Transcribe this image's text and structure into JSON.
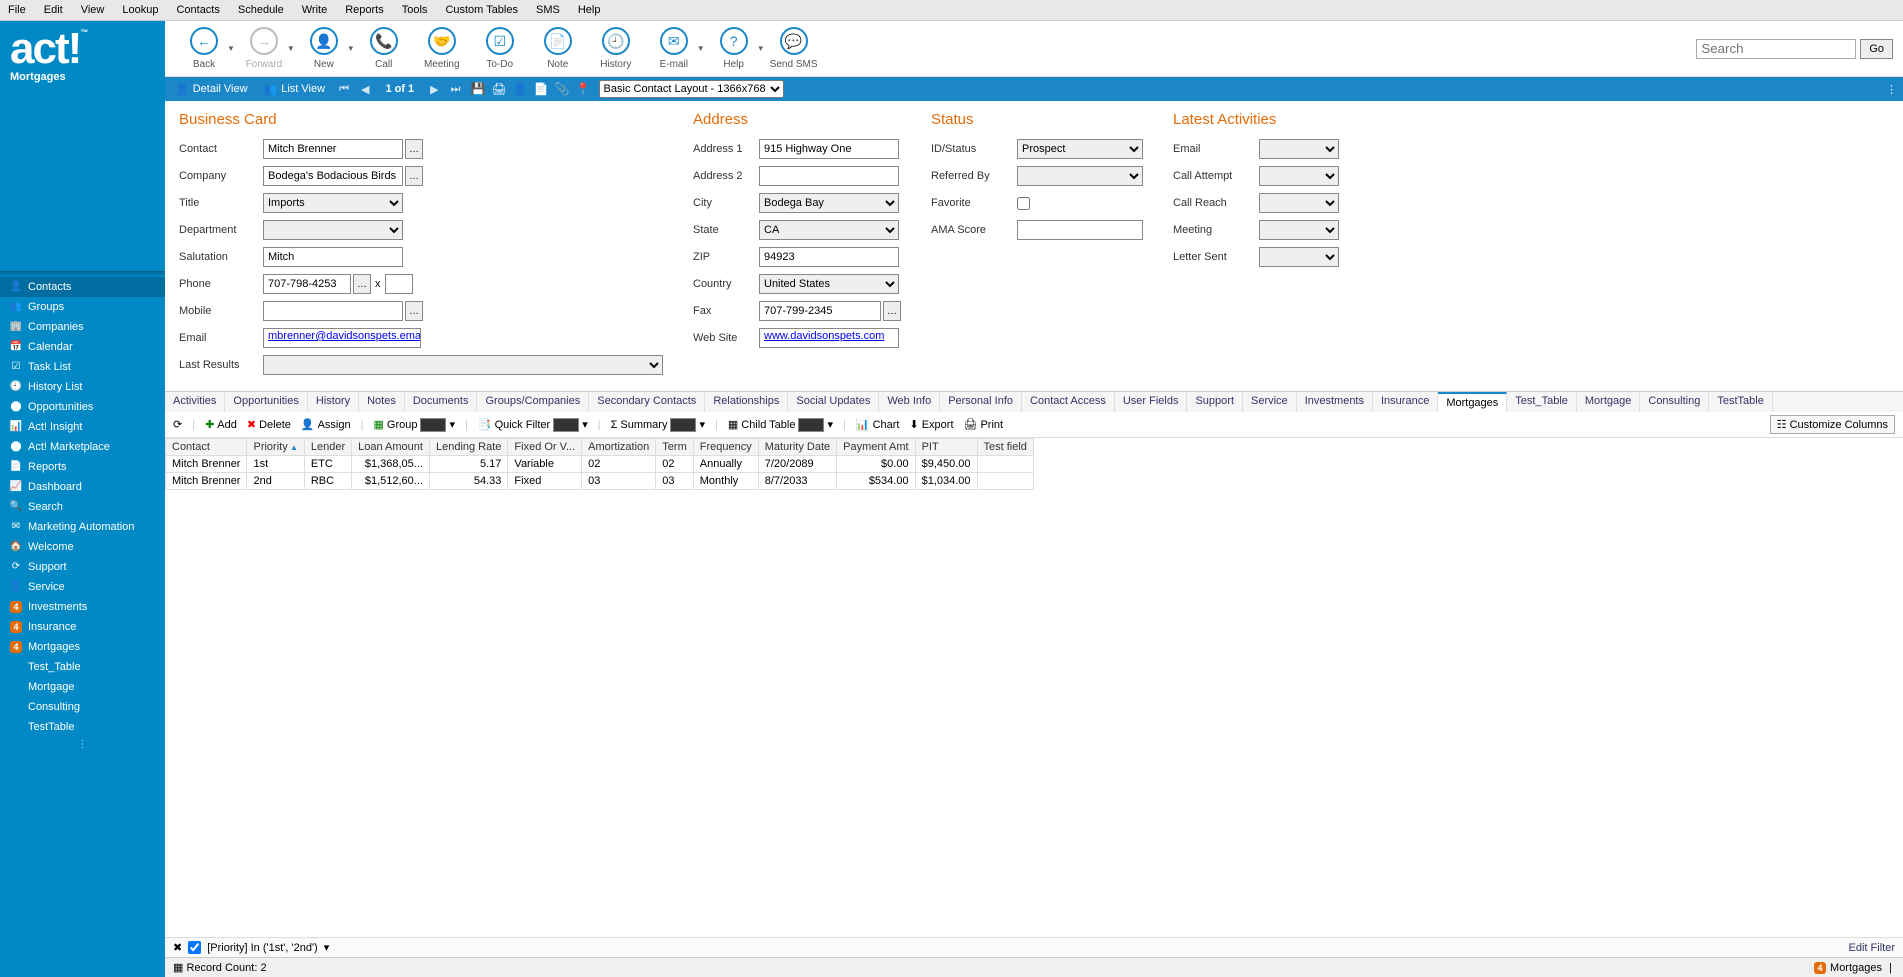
{
  "menu": [
    "File",
    "Edit",
    "View",
    "Lookup",
    "Contacts",
    "Schedule",
    "Write",
    "Reports",
    "Tools",
    "Custom Tables",
    "SMS",
    "Help"
  ],
  "logo": {
    "text": "act!",
    "sub": "Mortgages"
  },
  "toolbar": [
    {
      "id": "back",
      "label": "Back",
      "icon": "←",
      "drop": true
    },
    {
      "id": "forward",
      "label": "Forward",
      "icon": "→",
      "disabled": true,
      "drop": true
    },
    {
      "id": "new",
      "label": "New",
      "icon": "👤",
      "drop": true
    },
    {
      "id": "call",
      "label": "Call",
      "icon": "📞"
    },
    {
      "id": "meeting",
      "label": "Meeting",
      "icon": "🤝"
    },
    {
      "id": "todo",
      "label": "To-Do",
      "icon": "☑"
    },
    {
      "id": "note",
      "label": "Note",
      "icon": "📄"
    },
    {
      "id": "history",
      "label": "History",
      "icon": "🕘"
    },
    {
      "id": "email",
      "label": "E-mail",
      "icon": "✉",
      "drop": true
    },
    {
      "id": "help",
      "label": "Help",
      "icon": "?",
      "drop": true
    },
    {
      "id": "sendsms",
      "label": "Send SMS",
      "icon": "💬"
    }
  ],
  "search": {
    "placeholder": "Search",
    "go": "Go"
  },
  "subbar": {
    "detail": "Detail View",
    "list": "List View",
    "paging": "1 of 1",
    "layoutSelect": "Basic Contact Layout - 1366x768"
  },
  "nav": [
    {
      "id": "contacts",
      "label": "Contacts",
      "icon": "👤",
      "active": true
    },
    {
      "id": "groups",
      "label": "Groups",
      "icon": "👥"
    },
    {
      "id": "companies",
      "label": "Companies",
      "icon": "🏢"
    },
    {
      "id": "calendar",
      "label": "Calendar",
      "icon": "📅"
    },
    {
      "id": "tasklist",
      "label": "Task List",
      "icon": "☑"
    },
    {
      "id": "historylist",
      "label": "History List",
      "icon": "🕘"
    },
    {
      "id": "opportunities",
      "label": "Opportunities",
      "icon": "⬤"
    },
    {
      "id": "insight",
      "label": "Act! Insight",
      "icon": "📊"
    },
    {
      "id": "marketplace",
      "label": "Act! Marketplace",
      "icon": "⬤"
    },
    {
      "id": "reports",
      "label": "Reports",
      "icon": "📄"
    },
    {
      "id": "dashboard",
      "label": "Dashboard",
      "icon": "📈"
    },
    {
      "id": "searchnav",
      "label": "Search",
      "icon": "🔍"
    },
    {
      "id": "marketing",
      "label": "Marketing Automation",
      "icon": "✉"
    },
    {
      "id": "welcome",
      "label": "Welcome",
      "icon": "🏠"
    },
    {
      "id": "support",
      "label": "Support",
      "icon": "⟳"
    },
    {
      "id": "service",
      "label": "Service",
      "icon": "👤"
    },
    {
      "id": "investments",
      "label": "Investments",
      "icon": "4",
      "badge": true
    },
    {
      "id": "insurance",
      "label": "Insurance",
      "icon": "4",
      "badge": true
    },
    {
      "id": "mortgages",
      "label": "Mortgages",
      "icon": "4",
      "badge": true
    },
    {
      "id": "testtable",
      "label": "Test_Table",
      "icon": ""
    },
    {
      "id": "mortgage",
      "label": "Mortgage",
      "icon": ""
    },
    {
      "id": "consulting",
      "label": "Consulting",
      "icon": ""
    },
    {
      "id": "testtable2",
      "label": "TestTable",
      "icon": ""
    }
  ],
  "sections": {
    "businessCard": "Business Card",
    "address": "Address",
    "status": "Status",
    "latest": "Latest Activities"
  },
  "labels": {
    "contact": "Contact",
    "company": "Company",
    "title": "Title",
    "department": "Department",
    "salutation": "Salutation",
    "phone": "Phone",
    "mobile": "Mobile",
    "email": "Email",
    "lastResults": "Last Results",
    "address1": "Address 1",
    "address2": "Address 2",
    "city": "City",
    "state": "State",
    "zip": "ZIP",
    "country": "Country",
    "fax": "Fax",
    "website": "Web Site",
    "idstatus": "ID/Status",
    "referredby": "Referred By",
    "favorite": "Favorite",
    "amascore": "AMA Score",
    "aemail": "Email",
    "callattempt": "Call Attempt",
    "callreach": "Call Reach",
    "meeting": "Meeting",
    "lettersent": "Letter Sent",
    "x": "x"
  },
  "values": {
    "contact": "Mitch Brenner",
    "company": "Bodega's Bodacious Birds",
    "title": "Imports",
    "department": "",
    "salutation": "Mitch",
    "phone": "707-798-4253",
    "mobile": "",
    "email": "mbrenner@davidsonspets.ema",
    "lastResults": "",
    "address1": "915 Highway One",
    "address2": "",
    "city": "Bodega Bay",
    "state": "CA",
    "zip": "94923",
    "country": "United States",
    "fax": "707-799-2345",
    "website": "www.davidsonspets.com",
    "idstatus": "Prospect",
    "referredby": "",
    "favorite": false,
    "amascore": ""
  },
  "tabs": [
    "Activities",
    "Opportunities",
    "History",
    "Notes",
    "Documents",
    "Groups/Companies",
    "Secondary Contacts",
    "Relationships",
    "Social Updates",
    "Web Info",
    "Personal Info",
    "Contact Access",
    "User Fields",
    "Support",
    "Service",
    "Investments",
    "Insurance",
    "Mortgages",
    "Test_Table",
    "Mortgage",
    "Consulting",
    "TestTable"
  ],
  "activeTab": "Mortgages",
  "gridbar": {
    "refresh": "⟳",
    "add": "Add",
    "delete": "Delete",
    "assign": "Assign",
    "group": "Group",
    "quickfilter": "Quick Filter",
    "summary": "Summary",
    "childtable": "Child Table",
    "chart": "Chart",
    "export": "Export",
    "print": "Print",
    "customize": "Customize Columns"
  },
  "grid": {
    "headers": [
      "Contact",
      "Priority",
      "Lender",
      "Loan Amount",
      "Lending Rate",
      "Fixed Or V...",
      "Amortization",
      "Term",
      "Frequency",
      "Maturity Date",
      "Payment Amt",
      "PIT",
      "Test field"
    ],
    "sortCol": "Priority",
    "rows": [
      {
        "Contact": "Mitch Brenner",
        "Priority": "1st",
        "Lender": "ETC",
        "Loan Amount": "$1,368,05...",
        "Lending Rate": "5.17",
        "Fixed Or V...": "Variable",
        "Amortization": "02",
        "Term": "02",
        "Frequency": "Annually",
        "Maturity Date": "7/20/2089",
        "Payment Amt": "$0.00",
        "PIT": "$9,450.00",
        "Test field": ""
      },
      {
        "Contact": "Mitch Brenner",
        "Priority": "2nd",
        "Lender": "RBC",
        "Loan Amount": "$1,512,60...",
        "Lending Rate": "54.33",
        "Fixed Or V...": "Fixed",
        "Amortization": "03",
        "Term": "03",
        "Frequency": "Monthly",
        "Maturity Date": "8/7/2033",
        "Payment Amt": "$534.00",
        "PIT": "$1,034.00",
        "Test field": ""
      }
    ]
  },
  "filter": {
    "text": "[Priority] In ('1st', '2nd')",
    "edit": "Edit Filter"
  },
  "status": {
    "count": "Record Count: 2",
    "rightLabel": "Mortgages"
  }
}
